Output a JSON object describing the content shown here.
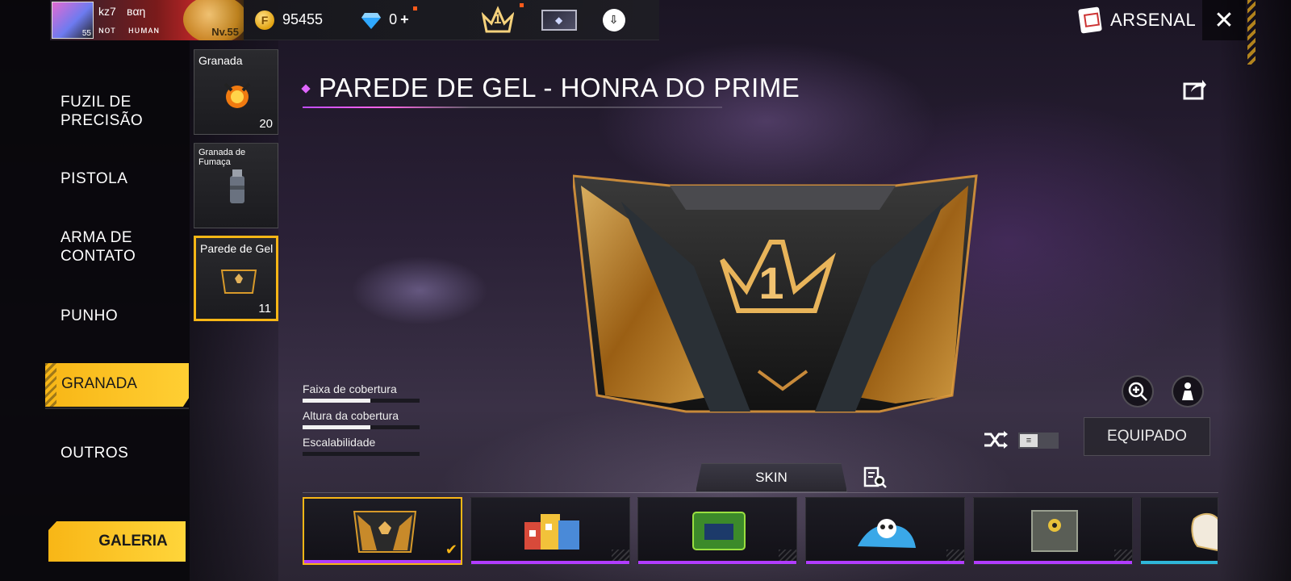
{
  "player": {
    "level_badge": "55",
    "name_part1": "kz7",
    "name_part2": "ʙαη",
    "tag_part1": "ɴᴏᴛ",
    "tag_part2": "ʜᴜᴍᴀɴ",
    "level": "Nv.55"
  },
  "currency": {
    "coins": "95455",
    "diamonds": "0",
    "coin_icon": "coin-icon",
    "diamond_icon": "diamond-icon"
  },
  "rank_icon_number": "1",
  "header": {
    "arsenal_label": "ARSENAL",
    "close_icon": "close-icon"
  },
  "nav": {
    "items": [
      {
        "label": "FUZIL DE\nPRECISÃO"
      },
      {
        "label": "PISTOLA"
      },
      {
        "label": "ARMA DE\nCONTATO"
      },
      {
        "label": "PUNHO"
      },
      {
        "label": "GRANADA"
      },
      {
        "label": "OUTROS"
      }
    ],
    "active_index": 4,
    "gallery_label": "GALERIA"
  },
  "items": [
    {
      "name": "Granada",
      "count": "20"
    },
    {
      "name": "Granada de Fumaça",
      "count": ""
    },
    {
      "name": "Parede de Gel",
      "count": "11"
    }
  ],
  "title": "PAREDE DE GEL - HONRA DO PRIME",
  "stats": [
    {
      "label": "Faixa de cobertura",
      "value": 0.58
    },
    {
      "label": "Altura da cobertura",
      "value": 0.58
    },
    {
      "label": "Escalabilidade",
      "value": 0.0
    }
  ],
  "controls": {
    "equip_label": "EQUIPADO",
    "skin_tab_label": "SKIN"
  },
  "skins": [
    {
      "id": "honra-do-prime",
      "selected": true,
      "bar_color": "#b13cff"
    },
    {
      "id": "skin-2",
      "selected": false,
      "bar_color": "#b13cff"
    },
    {
      "id": "skin-3",
      "selected": false,
      "bar_color": "#b13cff"
    },
    {
      "id": "skin-4",
      "selected": false,
      "bar_color": "#b13cff"
    },
    {
      "id": "skin-5",
      "selected": false,
      "bar_color": "#b13cff"
    },
    {
      "id": "skin-6",
      "selected": false,
      "bar_color": "#2fb6d8"
    }
  ],
  "colors": {
    "accent": "#f8b616",
    "title_accent": "#e066ff"
  }
}
